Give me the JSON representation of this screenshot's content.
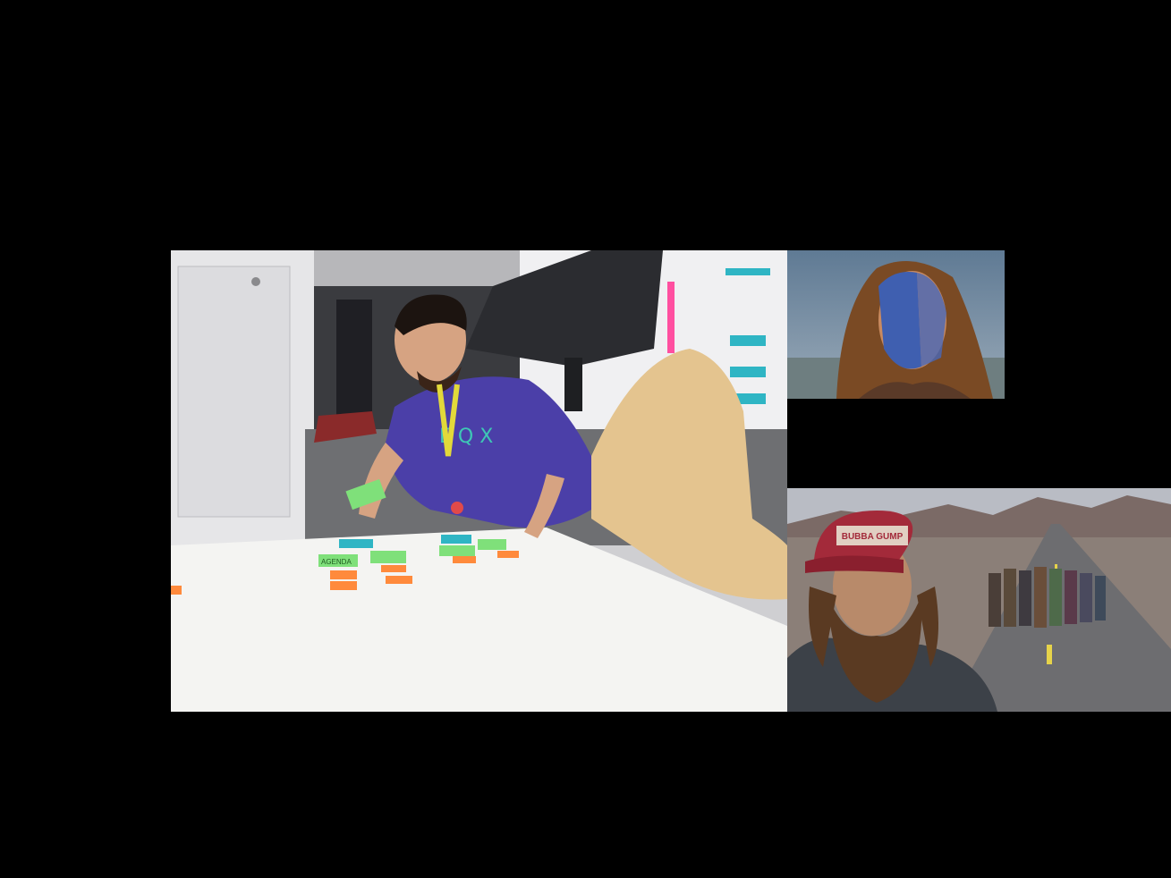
{
  "slide": {
    "background": "#000000"
  },
  "main_photo": {
    "sticky_notes": {
      "note_a": "AGENDA",
      "note_b": "",
      "note_c": "",
      "note_d": ""
    },
    "colors": {
      "sticky_green": "#7fe07a",
      "sticky_orange": "#ff8a3c",
      "sticky_teal": "#2fb5c4",
      "shirt": "#4b3fa8",
      "pants": "#e4c48f",
      "lanyard": "#e2d93a"
    }
  },
  "inset_top": {
    "colors": {
      "sky": "#6f8aa0",
      "face_paint": "#3f5fb0",
      "hair": "#7a4a24"
    }
  },
  "inset_bottom": {
    "cap_text": "BUBBA GUMP",
    "colors": {
      "sky": "#b9bcc4",
      "road": "#6d6d70",
      "cap": "#a32a3a",
      "beard": "#5a3a22"
    }
  }
}
